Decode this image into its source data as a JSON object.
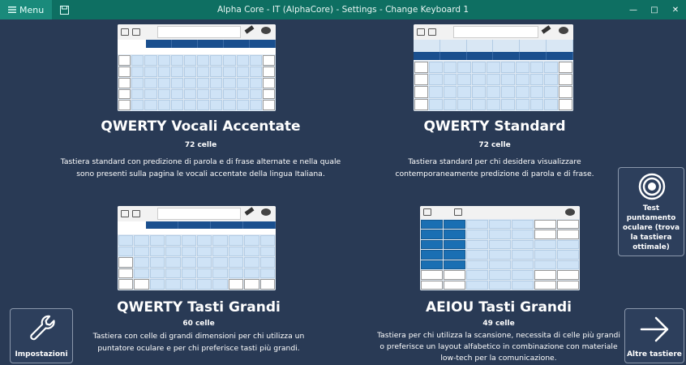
{
  "titlebar": {
    "menu_label": "Menu",
    "title": "Alpha Core - IT (AlphaCore) - Settings - Change Keyboard 1",
    "accent": "#0e6f62"
  },
  "cards": [
    {
      "title": "QWERTY Vocali Accentate",
      "count": "72 celle",
      "desc": "Tastiera standard con predizione di parola e di frase alternate e nella quale sono presenti sulla pagina le vocali accentate della lingua Italiana."
    },
    {
      "title": "QWERTY Standard",
      "count": "72 celle",
      "desc": "Tastiera standard per chi desidera visualizzare contemporaneamente predizione di parola e di frase."
    },
    {
      "title": "QWERTY Tasti Grandi",
      "count": "60 celle",
      "desc": "Tastiera con celle di grandi dimensioni per chi utilizza un puntatore oculare e per chi preferisce tasti più grandi."
    },
    {
      "title": "AEIOU Tasti Grandi",
      "count": "49 celle",
      "desc": "Tastiera per chi utilizza la scansione, necessita di celle più grandi o preferisce un layout alfabetico in combinazione con materiale low-tech per la comunicazione."
    }
  ],
  "side_buttons": {
    "settings_label": "Impostazioni",
    "eye_test_label": "Test puntamento oculare (trova la tastiera ottimale)",
    "more_label": "Altre tastiere"
  },
  "icons": {
    "menu": "hamburger-icon",
    "save": "floppy-disk-icon",
    "settings": "wrench-icon",
    "eye_test": "target-icon",
    "more": "arrow-right-icon"
  }
}
